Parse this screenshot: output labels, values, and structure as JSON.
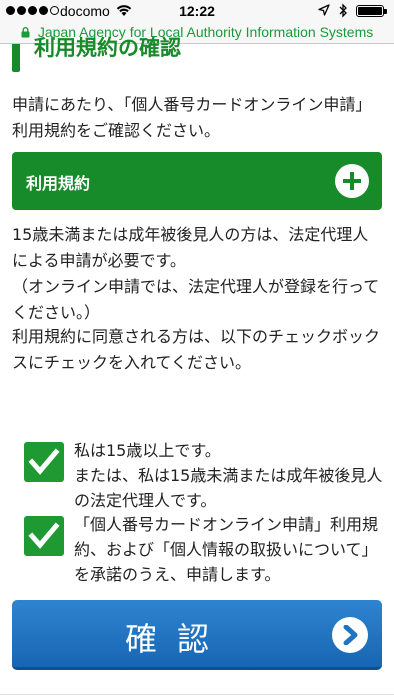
{
  "status_bar": {
    "carrier": "docomo",
    "time": "12:22",
    "signal_bars_filled": 4,
    "signal_bars_total": 5
  },
  "browser": {
    "url_text": "Japan Agency for Local Authority Information Systems",
    "secure_color": "#1a9a3a"
  },
  "section": {
    "title": "利用規約の確認"
  },
  "intro": "申請にあたり、「個人番号カードオンライン申請」利用規約をご確認ください。",
  "terms_accordion": {
    "label": "利用規約",
    "icon": "plus-icon"
  },
  "notice": {
    "line1": "15歳未満または成年被後見人の方は、法定代理人による申請が必要です。",
    "line2": "（オンライン申請では、法定代理人が登録を行ってください。）"
  },
  "agree_instruction": "利用規約に同意される方は、以下のチェックボックスにチェックを入れてください。",
  "checkboxes": [
    {
      "text": "私は15歳以上です。\nまたは、私は15歳未満または成年被後見人の法定代理人です。",
      "checked": true
    },
    {
      "text": "「個人番号カードオンライン申請」利用規約、および「個人情報の取扱いについて」を承諾のうえ、申請します。",
      "checked": true
    }
  ],
  "confirm_button": {
    "label": "確認",
    "icon": "chevron-right-icon"
  },
  "colors": {
    "accent_green": "#178a2a",
    "checkbox_green": "#1f9a32",
    "button_blue": "#1f74c2"
  }
}
